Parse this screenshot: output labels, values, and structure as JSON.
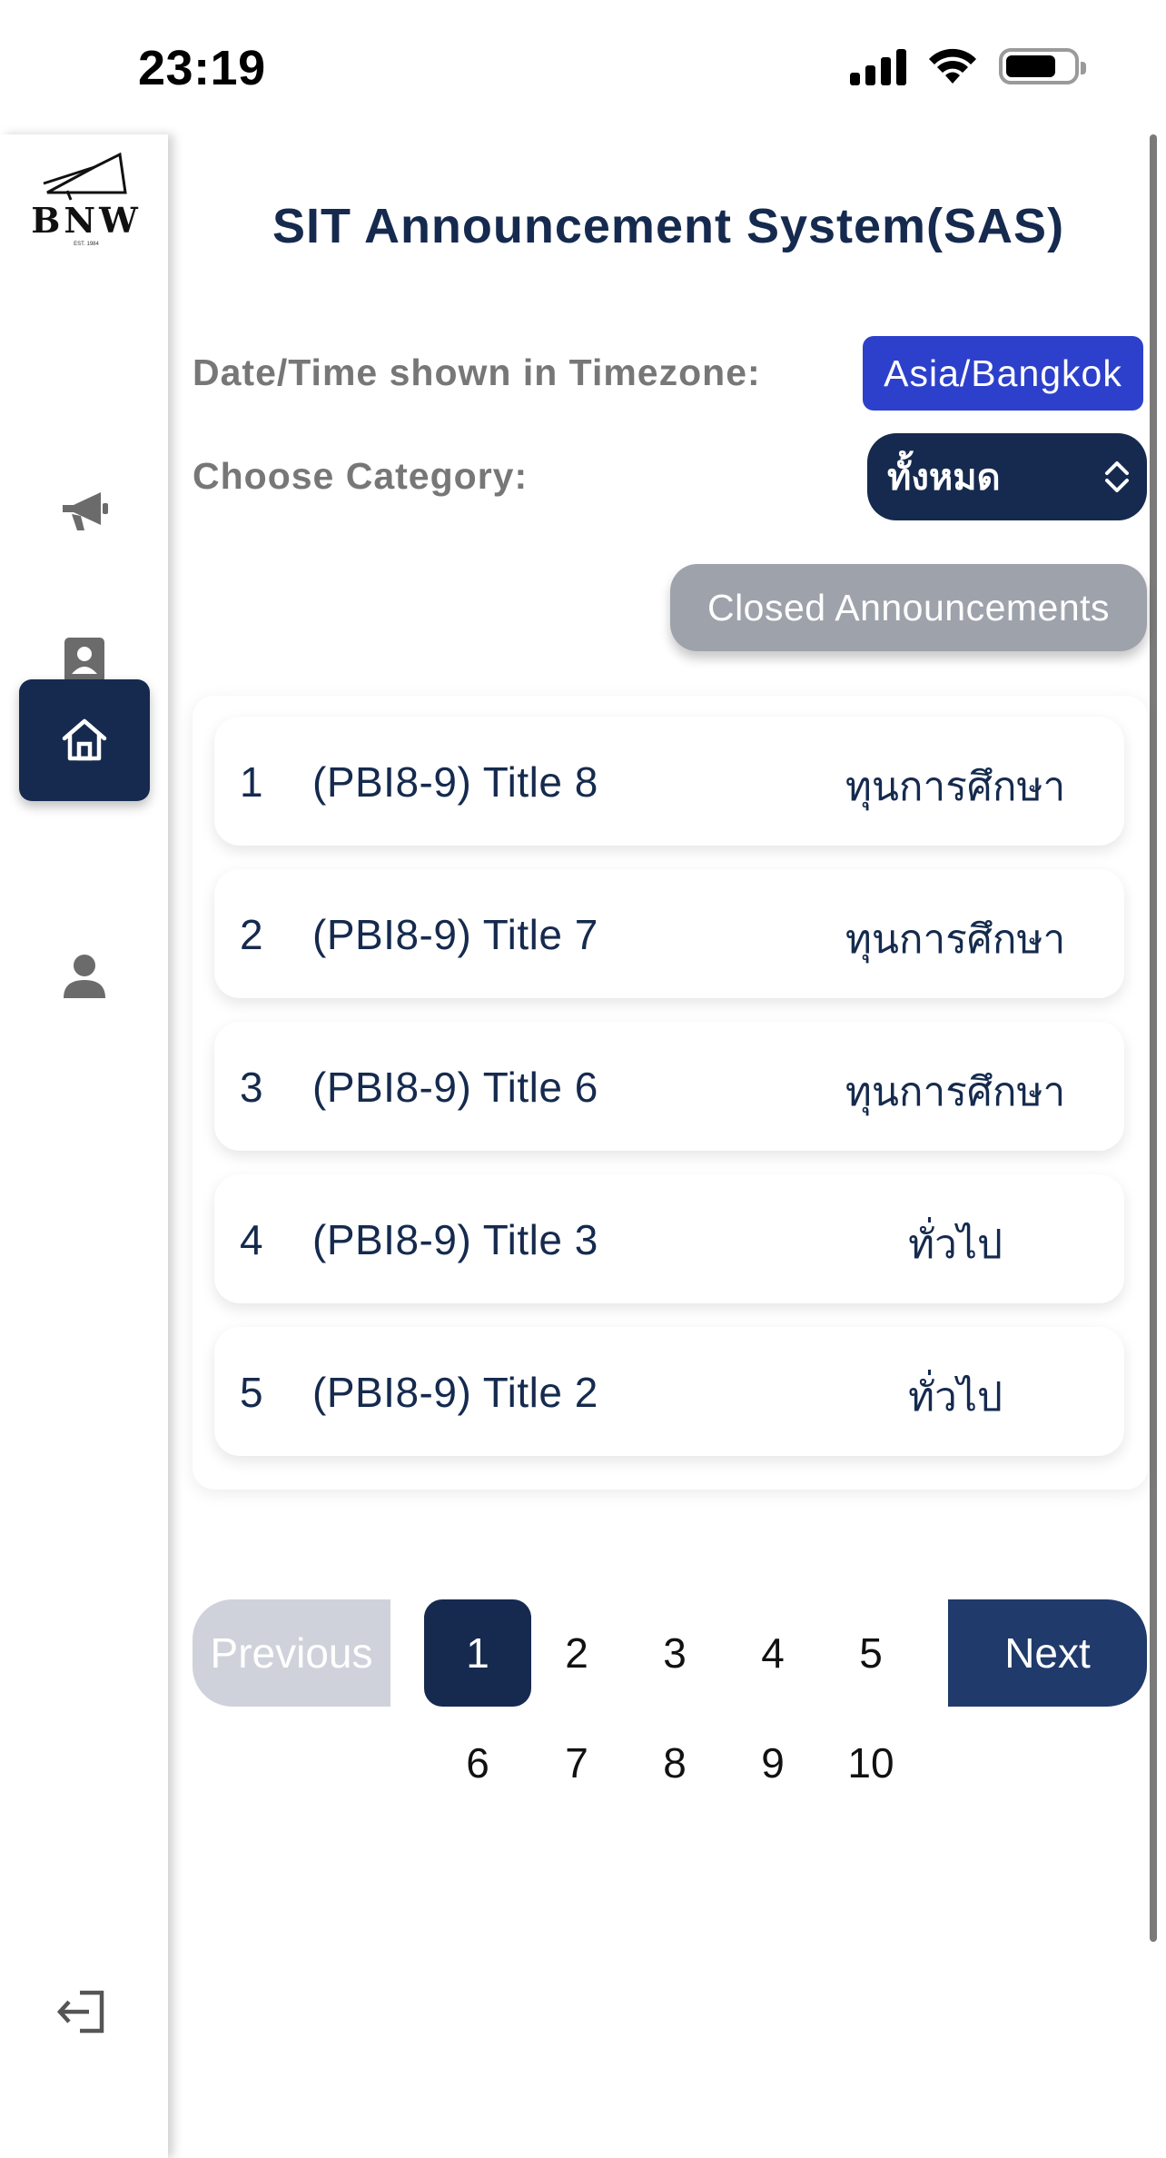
{
  "status_bar": {
    "time": "23:19"
  },
  "sidebar": {
    "logo": {
      "text": "BNW",
      "est": "EST. 1984"
    },
    "items": [
      {
        "name": "announcements",
        "icon": "megaphone-icon",
        "active": false
      },
      {
        "name": "contacts",
        "icon": "contact-card-icon",
        "active": false
      },
      {
        "name": "home",
        "icon": "home-icon",
        "active": true
      },
      {
        "name": "profile",
        "icon": "person-icon",
        "active": false
      }
    ],
    "logout_icon": "logout-icon"
  },
  "main": {
    "title": "SIT Announcement System(SAS)",
    "timezone_label": "Date/Time shown in Timezone:",
    "timezone_value": "Asia/Bangkok",
    "category_label": "Choose Category:",
    "category_selected": "ทั้งหมด",
    "closed_button": "Closed Announcements",
    "announcements": [
      {
        "no": "1",
        "title": "(PBI8-9) Title 8",
        "category": "ทุนการศึกษา"
      },
      {
        "no": "2",
        "title": "(PBI8-9) Title 7",
        "category": "ทุนการศึกษา"
      },
      {
        "no": "3",
        "title": "(PBI8-9) Title 6",
        "category": "ทุนการศึกษา"
      },
      {
        "no": "4",
        "title": "(PBI8-9) Title 3",
        "category": "ทั่วไป"
      },
      {
        "no": "5",
        "title": "(PBI8-9) Title 2",
        "category": "ทั่วไป"
      }
    ]
  },
  "pagination": {
    "previous": "Previous",
    "next": "Next",
    "current": "1",
    "pages": [
      "1",
      "2",
      "3",
      "4",
      "5",
      "6",
      "7",
      "8",
      "9",
      "10"
    ]
  },
  "colors": {
    "navy": "#152a4e",
    "blue_badge": "#2d40cc",
    "next_button": "#1f3a6b",
    "gray_button": "#9ea2ab",
    "disabled": "#cfd2da"
  }
}
